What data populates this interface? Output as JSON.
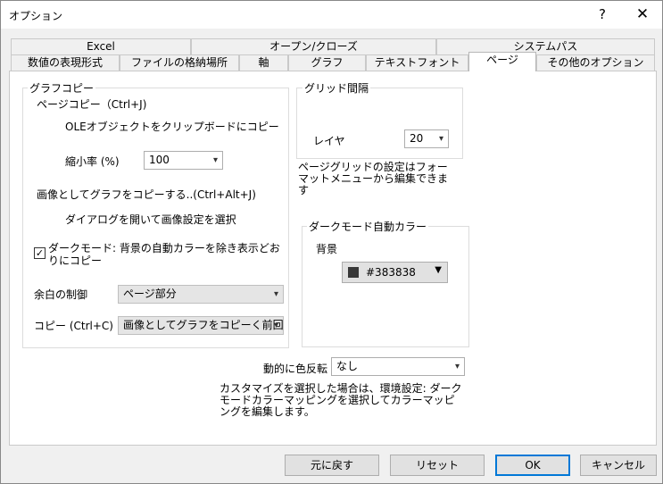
{
  "window": {
    "title": "オプション",
    "help_glyph": "?",
    "close_glyph": "✕"
  },
  "tabs": {
    "row1": [
      "Excel",
      "オープン/クローズ",
      "システムパス"
    ],
    "row2": [
      "数値の表現形式",
      "ファイルの格納場所",
      "軸",
      "グラフ",
      "テキストフォント",
      "ページ",
      "その他のオプション"
    ],
    "active": "ページ"
  },
  "graph_copy": {
    "title": "グラフコピー",
    "page_copy_label": "ページコピー（Ctrl+J)",
    "ole_note": "OLEオブジェクトをクリップボードにコピー",
    "scale_label": "縮小率 (%)",
    "scale_value": "100",
    "image_copy_label": "画像としてグラフをコピーする..(Ctrl+Alt+J)",
    "image_copy_note": "ダイアログを開いて画像設定を選択",
    "dark_mode_checkbox_label": "ダークモード: 背景の自動カラーを除き表示どおりにコピー",
    "dark_mode_checked": true,
    "margin_label": "余白の制御",
    "margin_value": "ページ部分",
    "copy_label": "コピー (Ctrl+C)",
    "copy_value": "画像としてグラフをコピーく前回と"
  },
  "grid": {
    "title": "グリッド間隔",
    "layer_label": "レイヤ",
    "layer_value": "20",
    "note": "ページグリッドの設定はフォーマットメニューから編集できます"
  },
  "dark_mode_auto_color": {
    "title": "ダークモード自動カラー",
    "background_label": "背景",
    "background_value": "#383838",
    "background_color": "#383838"
  },
  "dynamic_invert": {
    "label": "動的に色反転",
    "value": "なし",
    "note": "カスタマイズを選択した場合は、環境設定: ダークモードカラーマッピングを選択してカラーマッピングを編集します。"
  },
  "footer": {
    "revert": "元に戻す",
    "reset": "リセット",
    "ok": "OK",
    "cancel": "キャンセル"
  },
  "icons": {
    "dropdown": "▾",
    "check": "✓",
    "color_arrow": "▼"
  }
}
